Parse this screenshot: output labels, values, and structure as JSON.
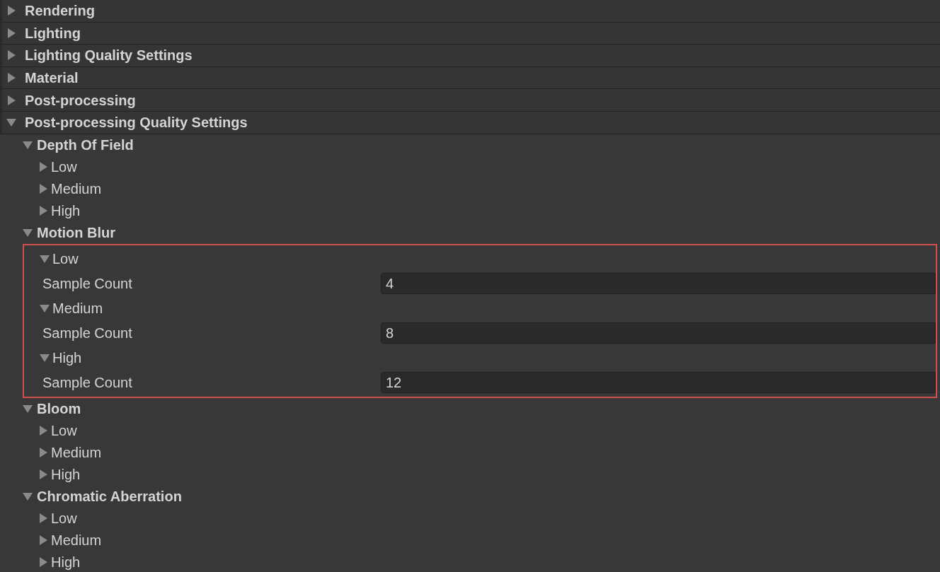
{
  "sections": [
    {
      "title": "Rendering",
      "expanded": false
    },
    {
      "title": "Lighting",
      "expanded": false
    },
    {
      "title": "Lighting Quality Settings",
      "expanded": false
    },
    {
      "title": "Material",
      "expanded": false
    },
    {
      "title": "Post-processing",
      "expanded": false
    },
    {
      "title": "Post-processing Quality Settings",
      "expanded": true,
      "children": [
        {
          "title": "Depth Of Field",
          "expanded": true,
          "highlighted": false,
          "children": [
            {
              "title": "Low",
              "expanded": false
            },
            {
              "title": "Medium",
              "expanded": false
            },
            {
              "title": "High",
              "expanded": false
            }
          ]
        },
        {
          "title": "Motion Blur",
          "expanded": true,
          "highlighted": true,
          "children": [
            {
              "title": "Low",
              "expanded": true,
              "fields": [
                {
                  "label": "Sample Count",
                  "value": "4"
                }
              ]
            },
            {
              "title": "Medium",
              "expanded": true,
              "fields": [
                {
                  "label": "Sample Count",
                  "value": "8"
                }
              ]
            },
            {
              "title": "High",
              "expanded": true,
              "fields": [
                {
                  "label": "Sample Count",
                  "value": "12"
                }
              ]
            }
          ]
        },
        {
          "title": "Bloom",
          "expanded": true,
          "highlighted": false,
          "children": [
            {
              "title": "Low",
              "expanded": false
            },
            {
              "title": "Medium",
              "expanded": false
            },
            {
              "title": "High",
              "expanded": false
            }
          ]
        },
        {
          "title": "Chromatic Aberration",
          "expanded": true,
          "highlighted": false,
          "children": [
            {
              "title": "Low",
              "expanded": false
            },
            {
              "title": "Medium",
              "expanded": false
            },
            {
              "title": "High",
              "expanded": false
            }
          ]
        }
      ]
    }
  ]
}
